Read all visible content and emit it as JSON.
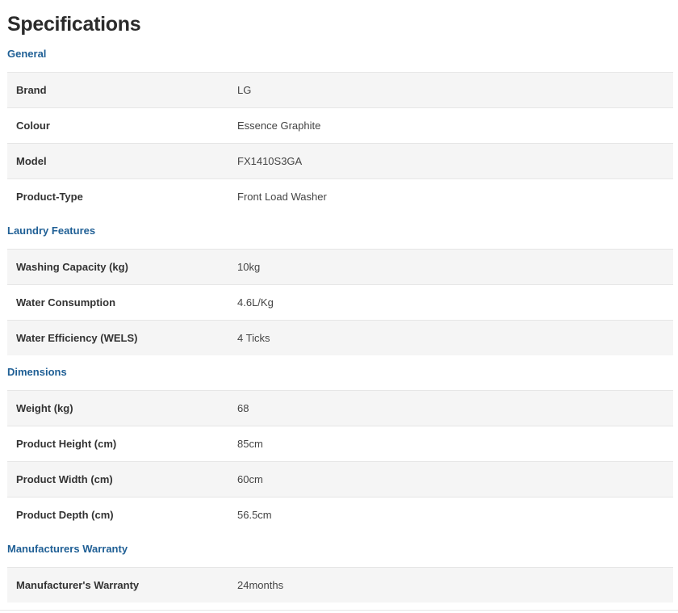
{
  "page": {
    "title": "Specifications"
  },
  "sections": [
    {
      "heading": "General",
      "rows": [
        {
          "label": "Brand",
          "value": "LG"
        },
        {
          "label": "Colour",
          "value": "Essence Graphite"
        },
        {
          "label": "Model",
          "value": "FX1410S3GA"
        },
        {
          "label": "Product-Type",
          "value": "Front Load Washer"
        }
      ]
    },
    {
      "heading": "Laundry Features",
      "rows": [
        {
          "label": "Washing Capacity (kg)",
          "value": "10kg"
        },
        {
          "label": "Water Consumption",
          "value": "4.6L/Kg"
        },
        {
          "label": "Water Efficiency (WELS)",
          "value": "4 Ticks"
        }
      ]
    },
    {
      "heading": "Dimensions",
      "rows": [
        {
          "label": "Weight (kg)",
          "value": "68"
        },
        {
          "label": "Product Height (cm)",
          "value": "85cm"
        },
        {
          "label": "Product Width (cm)",
          "value": "60cm"
        },
        {
          "label": "Product Depth (cm)",
          "value": "56.5cm"
        }
      ]
    },
    {
      "heading": "Manufacturers Warranty",
      "rows": [
        {
          "label": "Manufacturer's Warranty",
          "value": "24months"
        }
      ]
    }
  ]
}
